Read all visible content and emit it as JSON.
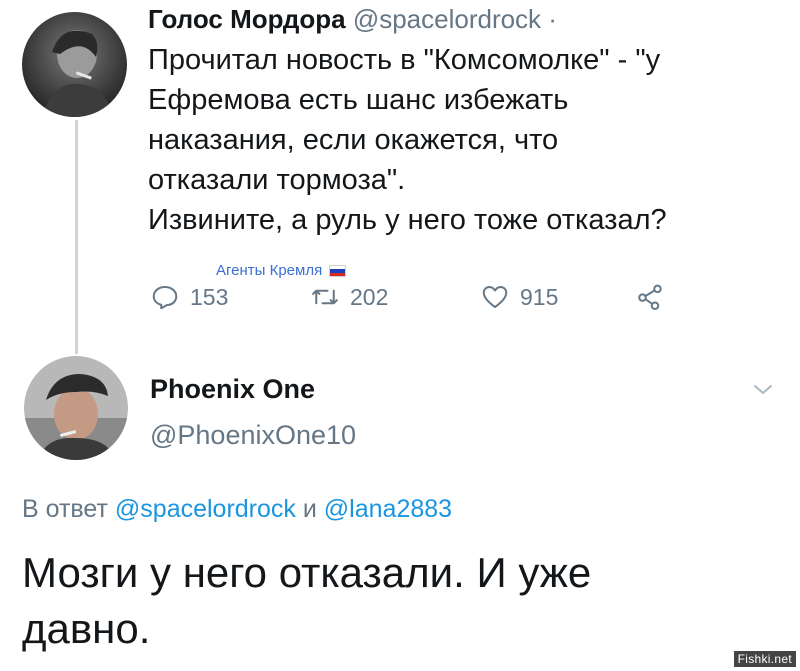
{
  "tweet1": {
    "display_name": "Голос Мордора",
    "handle": "@spacelordrock ·",
    "body_lines": [
      "Прочитал новость в \"Комсомолке\" - \"у",
      "Ефремова есть шанс избежать",
      "наказания, если окажется, что",
      "отказали тормоза\".",
      "Извините, а руль у него тоже отказал?"
    ],
    "watermark": "Агенты Кремля",
    "actions": {
      "reply_count": "153",
      "retweet_count": "202",
      "like_count": "915"
    },
    "icons": {
      "reply": "reply-icon",
      "retweet": "retweet-icon",
      "like": "heart-icon",
      "share": "share-icon"
    }
  },
  "tweet2": {
    "display_name": "Phoenix One",
    "handle": "@PhoenixOne10",
    "reply_prefix": "В ответ",
    "reply_mention_1": "@spacelordrock",
    "reply_joiner": "и",
    "reply_mention_2": "@lana2883",
    "body_lines": [
      "Мозги у него отказали. И уже",
      "давно."
    ]
  },
  "site_watermark": "Fishki.net",
  "colors": {
    "text": "#14171a",
    "secondary": "#657786",
    "link": "#1b95e0",
    "thread_line": "#ccd6dd",
    "watermark": "#3b6fd6"
  }
}
